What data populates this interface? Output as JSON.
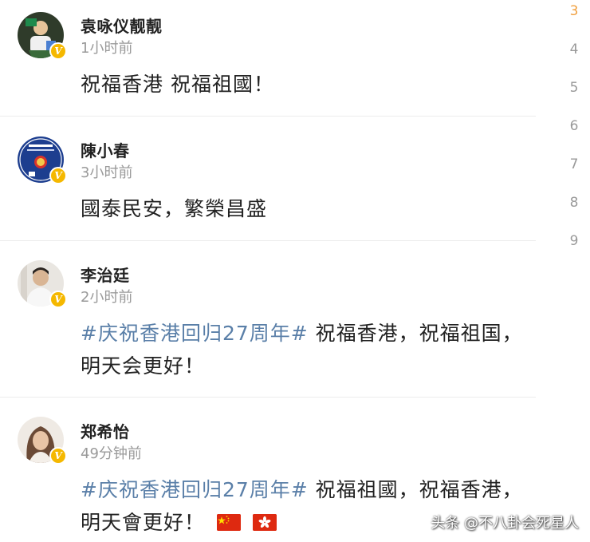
{
  "posts": [
    {
      "name": "袁咏仪靓靓",
      "time": "1小时前",
      "content": "祝福香港 祝福祖國！"
    },
    {
      "name": "陳小春",
      "time": "3小时前",
      "content": "國泰民安，繁榮昌盛"
    },
    {
      "name": "李治廷",
      "time": "2小时前",
      "hashtag": "#庆祝香港回归27周年#",
      "content": " 祝福香港，祝福祖国，明天会更好！"
    },
    {
      "name": "郑希怡",
      "time": "49分钟前",
      "hashtag": "#庆祝香港回归27周年#",
      "content": " 祝福祖國，祝福香港，明天會更好！",
      "flags": [
        "china-flag",
        "hong-kong-flag"
      ]
    }
  ],
  "badge_label": "V",
  "pager": {
    "pages": [
      "3",
      "4",
      "5",
      "6",
      "7",
      "8",
      "9"
    ],
    "active": "3"
  },
  "watermark": "头条 @不八卦会死星人",
  "colors": {
    "hashtag": "#5a7fa8",
    "badge": "#f5b800",
    "active_page": "#f0a040",
    "muted": "#9a9a9a"
  }
}
